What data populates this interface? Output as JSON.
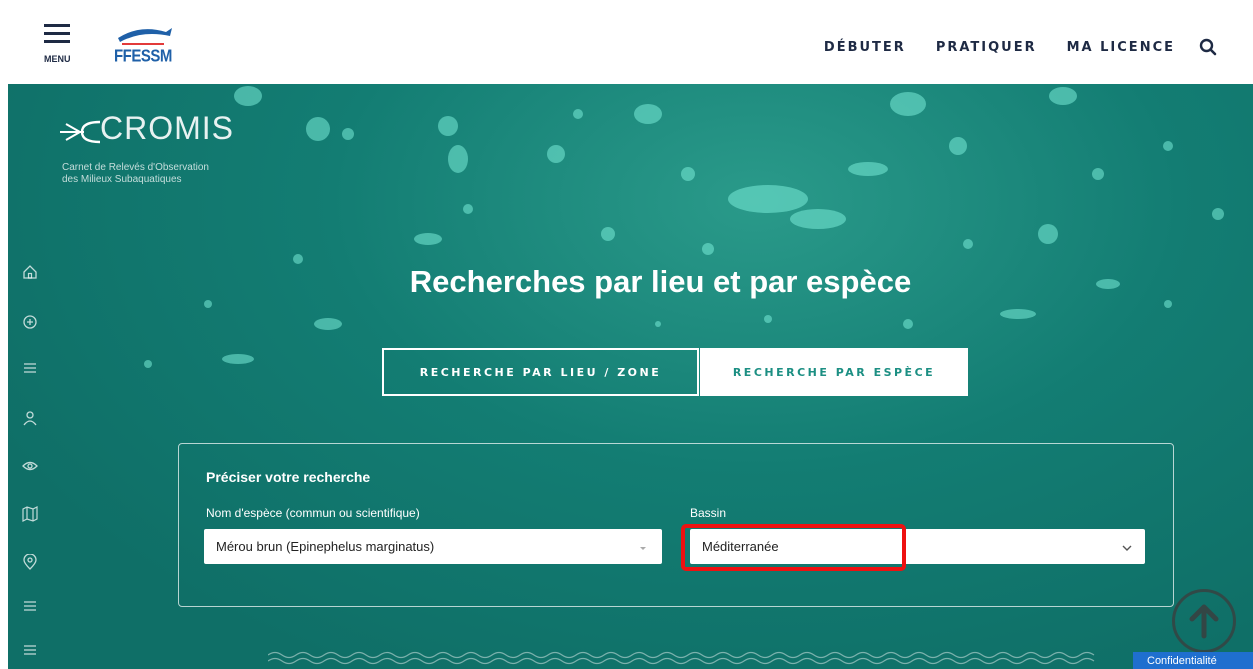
{
  "header": {
    "menu_label": "MENU",
    "logo_text": "FFESSM",
    "nav": [
      {
        "label": "DÉBUTER"
      },
      {
        "label": "PRATIQUER"
      },
      {
        "label": "MA LICENCE"
      }
    ]
  },
  "hero": {
    "brand": "CROMIS",
    "brand_sub_line1": "Carnet de Relevés d'Observation",
    "brand_sub_line2": "des Milieux Subaquatiques",
    "title": "Recherches par lieu et par espèce",
    "tabs": [
      {
        "label": "RECHERCHE PAR LIEU / ZONE",
        "active": false
      },
      {
        "label": "RECHERCHE PAR ESPÈCE",
        "active": true
      }
    ]
  },
  "search": {
    "title": "Préciser votre recherche",
    "species_label": "Nom d'espèce (commun ou scientifique)",
    "species_value": "Mérou brun (Epinephelus marginatus)",
    "bassin_label": "Bassin",
    "bassin_value": "Méditerranée"
  },
  "sidebar_icons": [
    "home-icon",
    "plus-circle-icon",
    "list-icon",
    "user-icon",
    "eye-icon",
    "map-icon",
    "location-pin-icon",
    "list-icon",
    "list-icon"
  ],
  "footer": {
    "confidentiality": "Confidentialité"
  },
  "colors": {
    "hero_teal": "#137d73",
    "nav_dark": "#1e2a44",
    "brand_blue": "#1f60a8",
    "highlight_red": "#ee1111",
    "tab_active_text": "#1c8f83"
  }
}
